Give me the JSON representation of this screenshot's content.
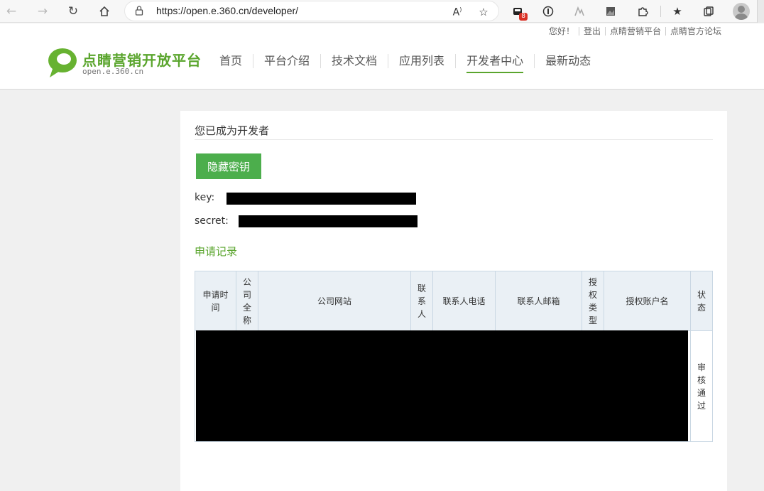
{
  "browser": {
    "url_prefix": "https://",
    "url_host": "open.e.360.cn",
    "url_path": "/developer/",
    "extension_badge": "8"
  },
  "header": {
    "toplinks": [
      "您好！",
      "登出",
      "点睛营销平台",
      "点睛官方论坛"
    ],
    "logo_title": "点睛营销开放平台",
    "logo_sub": "open.e.360.cn",
    "nav": [
      "首页",
      "平台介绍",
      "技术文档",
      "应用列表",
      "开发者中心",
      "最新动态"
    ],
    "active_nav": "开发者中心"
  },
  "card": {
    "title": "您已成为开发者",
    "hide_key_button": "隐藏密钥",
    "key_label": "key:",
    "secret_label": "secret:",
    "records_title": "申请记录",
    "columns": [
      "申请时间",
      "公司全称",
      "公司网站",
      "联系人",
      "联系人电话",
      "联系人邮箱",
      "授权类型",
      "授权账户名",
      "状态"
    ],
    "row_status": "审核通过"
  },
  "colors": {
    "brand_green": "#5aa52d",
    "button_green": "#4cae4c",
    "table_header_bg": "#eaf0f5"
  }
}
